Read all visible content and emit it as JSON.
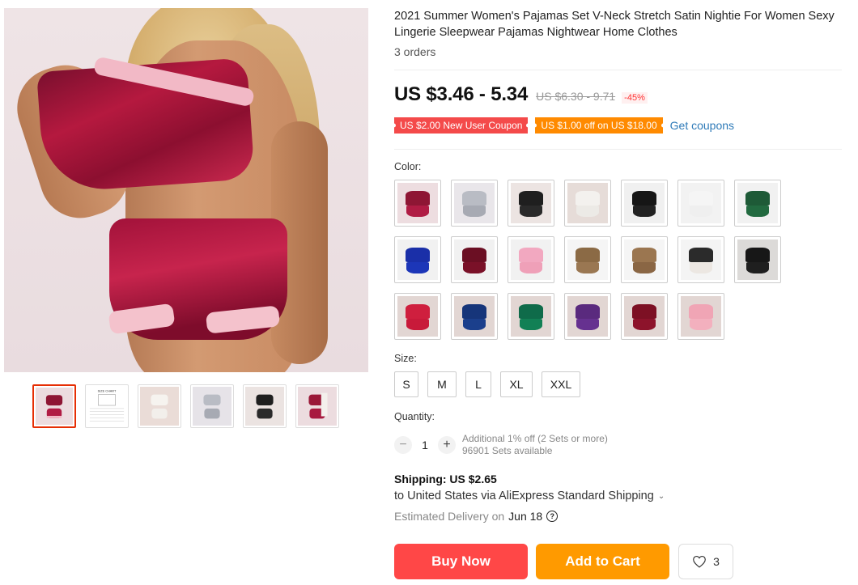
{
  "product": {
    "title": "2021 Summer Women's Pajamas Set V-Neck Stretch Satin Nightie For Women Sexy Lingerie Sleepwear Pajamas Nightwear Home Clothes",
    "orders": "3 orders"
  },
  "pricing": {
    "price": "US $3.46 - 5.34",
    "original": "US $6.30 - 9.71",
    "discount": "-45%"
  },
  "coupons": {
    "new_user": "US $2.00 New User Coupon",
    "off": "US $1.00 off on US $18.00",
    "get_label": "Get coupons"
  },
  "color": {
    "label": "Color:",
    "swatches": [
      {
        "icon": "wine-red-satin-set",
        "top": "#8e1634",
        "bottom": "#b01c44",
        "bg": "#eddde0"
      },
      {
        "icon": "silver-satin-set",
        "top": "#b9bcc4",
        "bottom": "#a7aab3",
        "bg": "#e9e6ea"
      },
      {
        "icon": "black-satin-set",
        "top": "#1f1f1f",
        "bottom": "#2a2a2a",
        "bg": "#ece4e2"
      },
      {
        "icon": "white-satin-set",
        "top": "#f3f1ee",
        "bottom": "#eceae6",
        "bg": "#e6dcd8"
      },
      {
        "icon": "black-lace-cami-set",
        "top": "#161616",
        "bottom": "#222222",
        "bg": "#f0f0f0"
      },
      {
        "icon": "white-cami-set",
        "top": "#f5f5f5",
        "bottom": "#efefef",
        "bg": "#f2f2f2"
      },
      {
        "icon": "green-cami-set",
        "top": "#1e5a37",
        "bottom": "#226a40",
        "bg": "#f1f1f1"
      },
      {
        "icon": "blue-cami-set",
        "top": "#1a2fa8",
        "bottom": "#1c36b8",
        "bg": "#f1f1f1"
      },
      {
        "icon": "burgundy-cami-set",
        "top": "#6b0f23",
        "bottom": "#7a1128",
        "bg": "#f1f1f1"
      },
      {
        "icon": "pink-cami-set",
        "top": "#f2a8c0",
        "bottom": "#efa0b8",
        "bg": "#f1f1f1"
      },
      {
        "icon": "leopard-lace-set",
        "top": "#8b6a45",
        "bottom": "#9a7752",
        "bg": "#f5f5f5"
      },
      {
        "icon": "leopard-slip-set",
        "top": "#9b7650",
        "bottom": "#8a6644",
        "bg": "#f5f5f5"
      },
      {
        "icon": "black-white-lace-set",
        "top": "#2b2b2b",
        "bottom": "#ece7e2",
        "bg": "#f4f4f4"
      },
      {
        "icon": "black-satin-lace-set",
        "top": "#171717",
        "bottom": "#1f1f1f",
        "bg": "#dcdad8"
      },
      {
        "icon": "red-satin-lace-set",
        "top": "#cf1f3e",
        "bottom": "#c81a3a",
        "bg": "#e2d6d3"
      },
      {
        "icon": "navy-satin-lace-set",
        "top": "#16357a",
        "bottom": "#1b3f8c",
        "bg": "#e2d6d3"
      },
      {
        "icon": "emerald-satin-lace-set",
        "top": "#0f6b4a",
        "bottom": "#128055",
        "bg": "#e2d6d3"
      },
      {
        "icon": "purple-satin-lace-set",
        "top": "#5a2a7e",
        "bottom": "#663190",
        "bg": "#e2d6d3"
      },
      {
        "icon": "wine-satin-lace-set",
        "top": "#7d1024",
        "bottom": "#8d132b",
        "bg": "#e2d6d3"
      },
      {
        "icon": "pink-satin-lace-set",
        "top": "#f0a5b5",
        "bottom": "#f3b0be",
        "bg": "#e2d6d3"
      }
    ]
  },
  "size": {
    "label": "Size:",
    "options": [
      "S",
      "M",
      "L",
      "XL",
      "XXL"
    ]
  },
  "quantity": {
    "label": "Quantity:",
    "minus": "−",
    "plus": "+",
    "value": "1",
    "note": "Additional 1% off (2 Sets or more)",
    "available": "96901 Sets available"
  },
  "shipping": {
    "title": "Shipping: US $2.65",
    "line": "to United States via AliExpress Standard Shipping",
    "chevron": "⌄",
    "estimated_label": "Estimated Delivery on",
    "date": "Jun 18",
    "help": "?"
  },
  "actions": {
    "buy": "Buy Now",
    "cart": "Add to Cart",
    "wish_count": "3",
    "buy_color": "#ff4747",
    "cart_color": "#ff9a00"
  },
  "gallery": {
    "thumbnails": [
      {
        "icon": "wine-red-set-thumb",
        "active": true
      },
      {
        "icon": "size-chart-thumb",
        "active": false,
        "text": "SIZE CHART"
      },
      {
        "icon": "white-set-thumb",
        "active": false
      },
      {
        "icon": "silver-set-thumb",
        "active": false
      },
      {
        "icon": "black-set-thumb",
        "active": false
      },
      {
        "icon": "wine-set-thumb-2",
        "active": false
      }
    ]
  }
}
